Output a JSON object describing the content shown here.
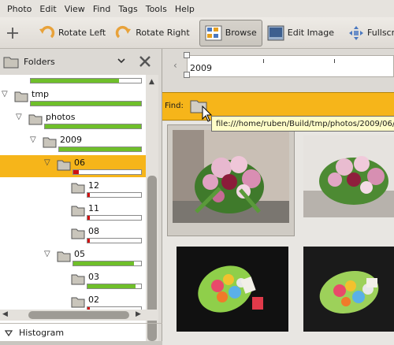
{
  "menu": [
    "Photo",
    "Edit",
    "View",
    "Find",
    "Tags",
    "Tools",
    "Help"
  ],
  "toolbar": {
    "rotate_left": "Rotate Left",
    "rotate_right": "Rotate Right",
    "browse": "Browse",
    "edit_image": "Edit Image",
    "fullscreen": "Fullscreen"
  },
  "sidebar": {
    "title": "Folders",
    "histogram_title": "Histogram",
    "tree": [
      {
        "label": "",
        "level": 0,
        "fill": 0.8,
        "color": "green"
      },
      {
        "label": "tmp",
        "level": 0,
        "fill": 1.0,
        "color": "green"
      },
      {
        "label": "photos",
        "level": 1,
        "fill": 1.0,
        "color": "green"
      },
      {
        "label": "2009",
        "level": 2,
        "fill": 1.0,
        "color": "green"
      },
      {
        "label": "06",
        "level": 3,
        "fill": 0.08,
        "color": "red",
        "selected": true
      },
      {
        "label": "12",
        "level": 4,
        "fill": 0.03,
        "color": "red"
      },
      {
        "label": "11",
        "level": 4,
        "fill": 0.03,
        "color": "red"
      },
      {
        "label": "08",
        "level": 4,
        "fill": 0.03,
        "color": "red"
      },
      {
        "label": "05",
        "level": 3,
        "fill": 0.9,
        "color": "green"
      },
      {
        "label": "03",
        "level": 4,
        "fill": 0.9,
        "color": "green"
      },
      {
        "label": "02",
        "level": 4,
        "fill": 0.03,
        "color": "red"
      }
    ]
  },
  "timeline": {
    "year": "2009"
  },
  "find": {
    "label": "Find:",
    "tooltip": "file:///home/ruben/Build/tmp/photos/2009/06/"
  },
  "photos": [
    {
      "name": "flowers-bouquet-1",
      "selected": true
    },
    {
      "name": "flowers-bouquet-2",
      "selected": false
    },
    {
      "name": "candy-bouquet-1",
      "selected": false
    },
    {
      "name": "candy-bouquet-2",
      "selected": false
    }
  ],
  "colors": {
    "accent": "#f6b51a",
    "green_bar": "#6fbf2a",
    "red_bar": "#d01010"
  }
}
